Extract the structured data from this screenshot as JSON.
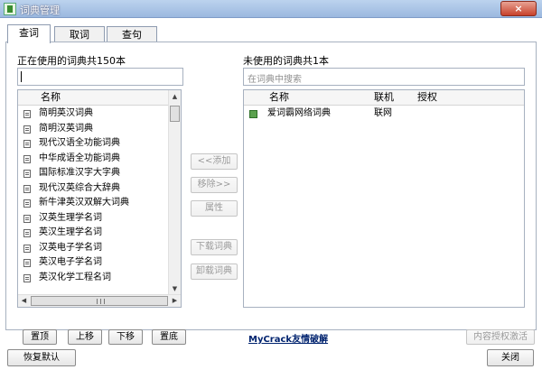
{
  "window": {
    "title": "词典管理",
    "close_glyph": "×"
  },
  "tabs": [
    {
      "label": "查词",
      "active": true
    },
    {
      "label": "取词",
      "active": false
    },
    {
      "label": "查句",
      "active": false
    }
  ],
  "left": {
    "count_label": "正在使用的词典共150本",
    "search_value": "",
    "column_name": "名称",
    "items": [
      "简明英汉词典",
      "简明汉英词典",
      "现代汉语全功能词典",
      "中华成语全功能词典",
      "国际标准汉字大字典",
      "现代汉英综合大辞典",
      "新牛津英汉双解大词典",
      "汉英生理学名词",
      "英汉生理学名词",
      "汉英电子学名词",
      "英汉电子学名词",
      "英汉化学工程名词"
    ]
  },
  "right": {
    "count_label": "未使用的词典共1本",
    "search_placeholder": "在词典中搜索",
    "columns": {
      "name": "名称",
      "online": "联机",
      "auth": "授权"
    },
    "items": [
      {
        "name": "爱词霸网络词典",
        "online": "联网",
        "auth": ""
      }
    ]
  },
  "middle_buttons": {
    "add": "<<添加",
    "remove": "移除>>",
    "properties": "属性",
    "download": "下载词典",
    "uninstall": "卸载词典"
  },
  "order_buttons": {
    "top": "置顶",
    "up": "上移",
    "down": "下移",
    "bottom": "置底"
  },
  "link_text": "MyCrack友情破解",
  "activate_label": "内容授权激活",
  "footer": {
    "restore_default": "恢复默认",
    "close": "关闭"
  },
  "icons": {
    "scroll_up": "▲",
    "scroll_down": "▼",
    "scroll_left": "◀",
    "scroll_right": "▶"
  }
}
